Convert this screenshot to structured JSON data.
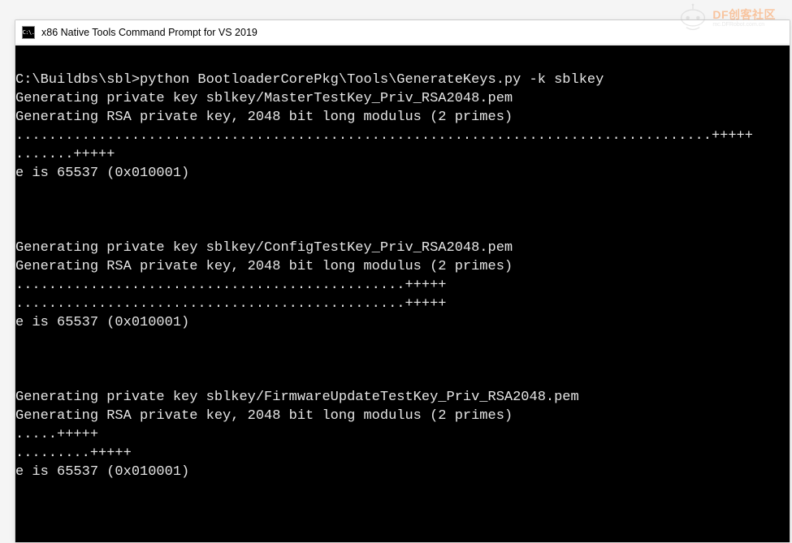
{
  "window": {
    "title": "x86 Native Tools Command Prompt for VS 2019",
    "icon_label": "C:\\."
  },
  "console": {
    "lines": [
      "",
      "C:\\Buildbs\\sbl>python BootloaderCorePkg\\Tools\\GenerateKeys.py -k sblkey",
      "Generating private key sblkey/MasterTestKey_Priv_RSA2048.pem",
      "Generating RSA private key, 2048 bit long modulus (2 primes)",
      "....................................................................................+++++",
      ".......+++++",
      "e is 65537 (0x010001)",
      "",
      "",
      "",
      "Generating private key sblkey/ConfigTestKey_Priv_RSA2048.pem",
      "Generating RSA private key, 2048 bit long modulus (2 primes)",
      "...............................................+++++",
      "...............................................+++++",
      "e is 65537 (0x010001)",
      "",
      "",
      "",
      "Generating private key sblkey/FirmwareUpdateTestKey_Priv_RSA2048.pem",
      "Generating RSA private key, 2048 bit long modulus (2 primes)",
      ".....+++++",
      ".........+++++",
      "e is 65537 (0x010001)",
      ""
    ]
  },
  "watermark": {
    "main": "DF创客社区",
    "sub": "mc.DFRobot.com.cn"
  }
}
